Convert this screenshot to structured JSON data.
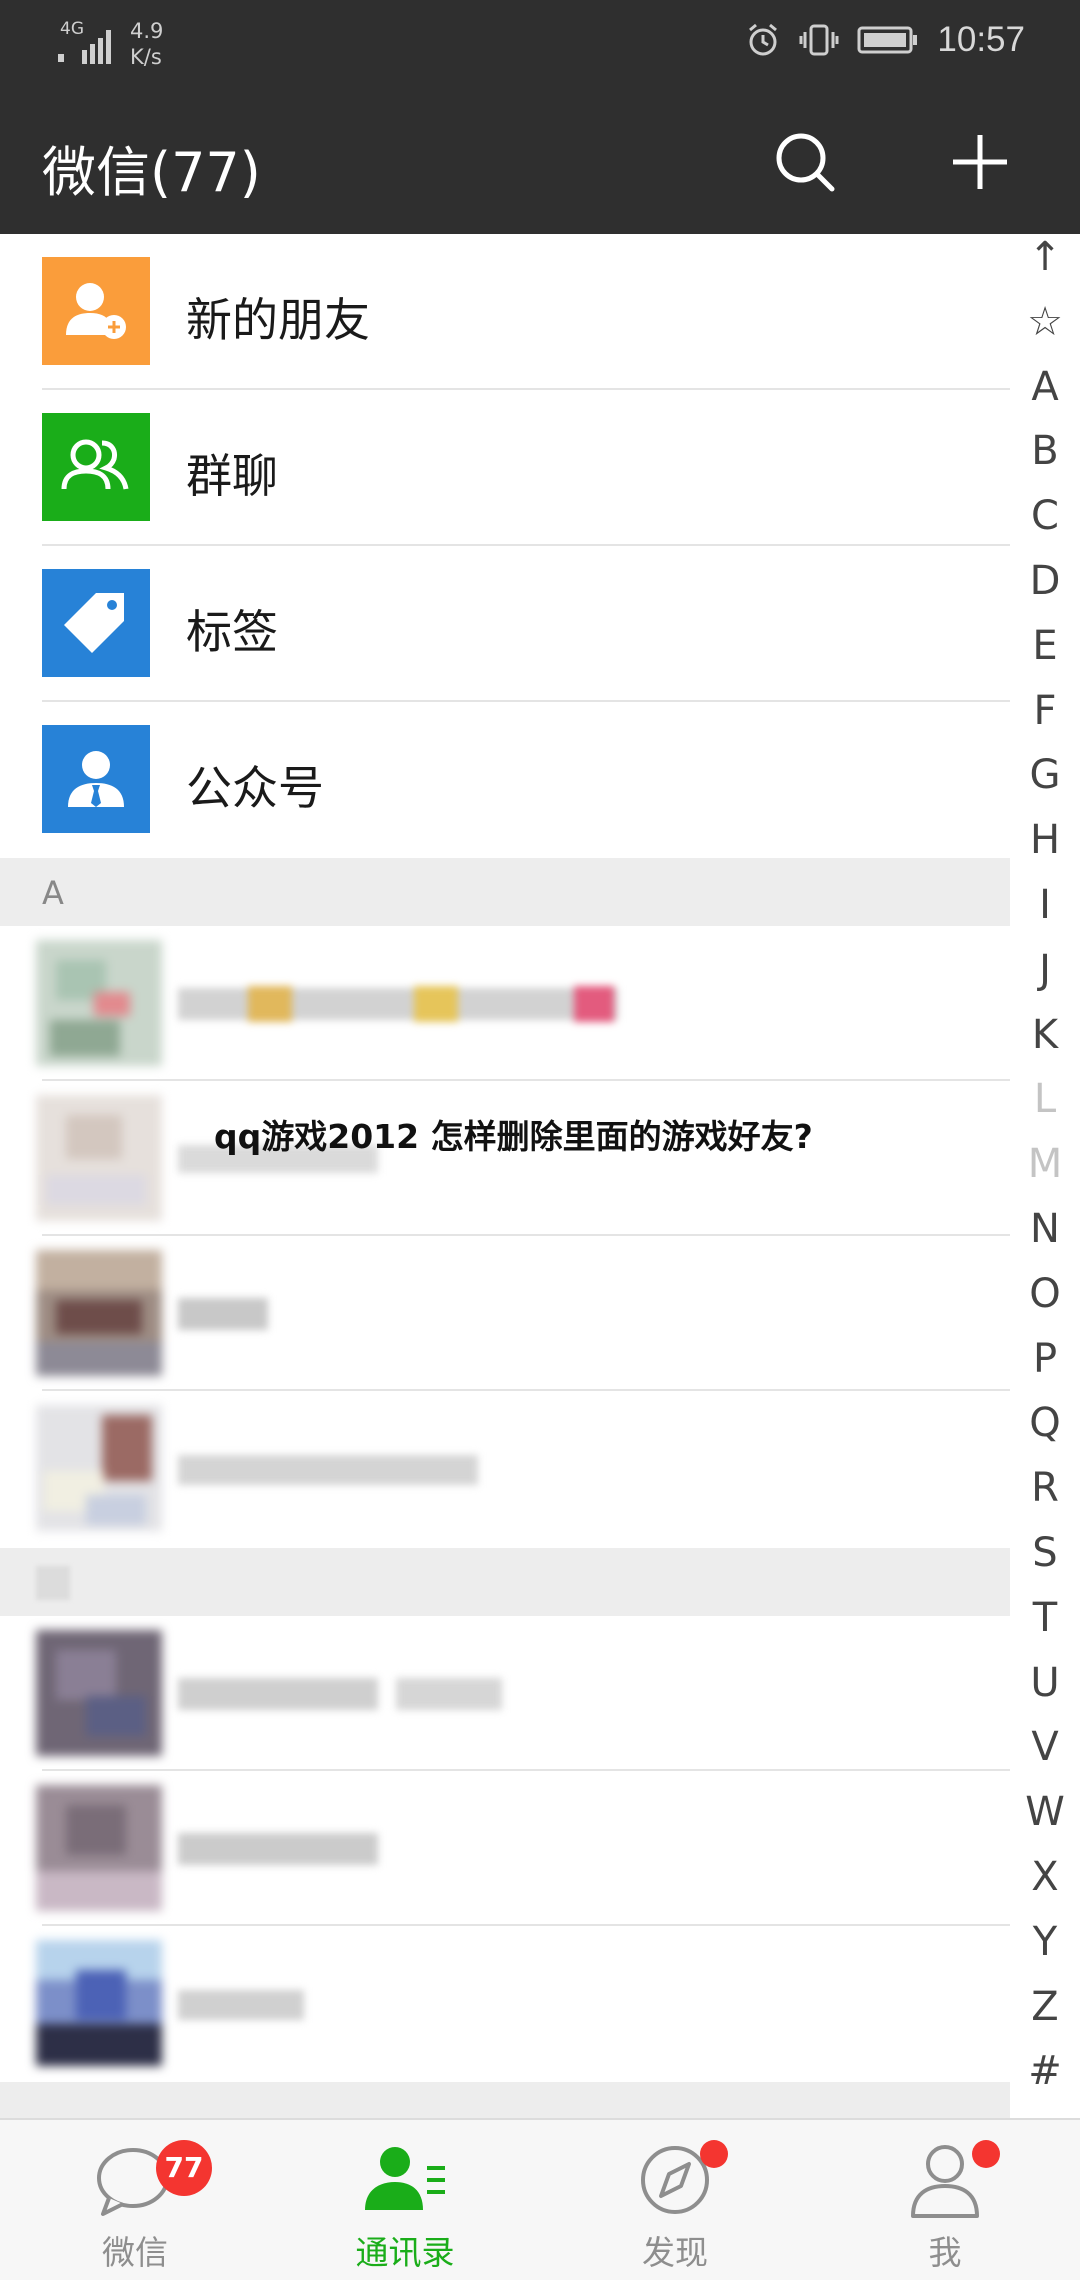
{
  "status_bar": {
    "network": "4G",
    "speed_value": "4.9",
    "speed_unit": "K/s",
    "time": "10:57"
  },
  "app_bar": {
    "title": "微信(77)",
    "search_icon": "search-icon",
    "add_icon": "plus-icon"
  },
  "menu": [
    {
      "label": "新的朋友",
      "icon": "add-friend-icon",
      "color": "#fa9d3b"
    },
    {
      "label": "群聊",
      "icon": "group-chat-icon",
      "color": "#1aad19"
    },
    {
      "label": "标签",
      "icon": "tag-icon",
      "color": "#2782d7"
    },
    {
      "label": "公众号",
      "icon": "official-account-icon",
      "color": "#2782d7"
    }
  ],
  "sections": [
    {
      "label": "A"
    }
  ],
  "overlay": {
    "text": "qq游戏2012 怎样删除里面的游戏好友?"
  },
  "index_bar": [
    "↑",
    "☆",
    "A",
    "B",
    "C",
    "D",
    "E",
    "F",
    "G",
    "H",
    "I",
    "J",
    "K",
    "L",
    "M",
    "N",
    "O",
    "P",
    "Q",
    "R",
    "S",
    "T",
    "U",
    "V",
    "W",
    "X",
    "Y",
    "Z",
    "#"
  ],
  "index_dimmed": [
    "L",
    "M"
  ],
  "tabs": [
    {
      "label": "微信",
      "icon": "chat-bubble-icon",
      "badge": "77",
      "active": false
    },
    {
      "label": "通讯录",
      "icon": "contacts-icon",
      "badge": "",
      "active": true
    },
    {
      "label": "发现",
      "icon": "compass-icon",
      "badge": "dot",
      "active": false
    },
    {
      "label": "我",
      "icon": "person-icon",
      "badge": "dot",
      "active": false
    }
  ],
  "colors": {
    "bar_bg": "#2f2f2f",
    "accent_green": "#1aad19",
    "badge_red": "#f43530",
    "section_bg": "#ededed"
  }
}
